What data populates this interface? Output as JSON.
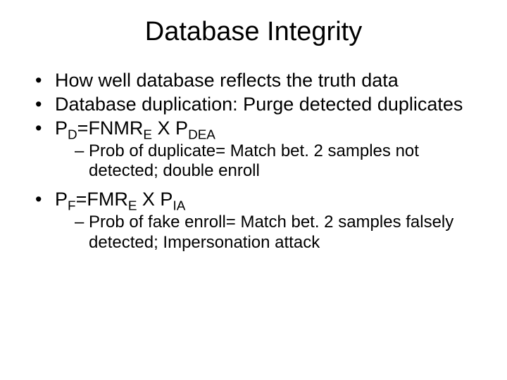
{
  "title": "Database Integrity",
  "bullets": {
    "b1": "How well database reflects the truth data",
    "b2": "Database duplication: Purge detected duplicates",
    "b3": {
      "P": "P",
      "D": "D",
      "eq": "=FNMR",
      "E": "E",
      "X": " X P",
      "DEA": "DEA"
    },
    "b3sub": "Prob of duplicate= Match bet. 2 samples not detected; double enroll",
    "b4": {
      "P": "P",
      "F": "F",
      "eq": "=FMR",
      "E": "E",
      "X": " X P",
      "IA": "IA"
    },
    "b4sub": "Prob of fake enroll= Match bet. 2 samples falsely detected; Impersonation attack"
  }
}
